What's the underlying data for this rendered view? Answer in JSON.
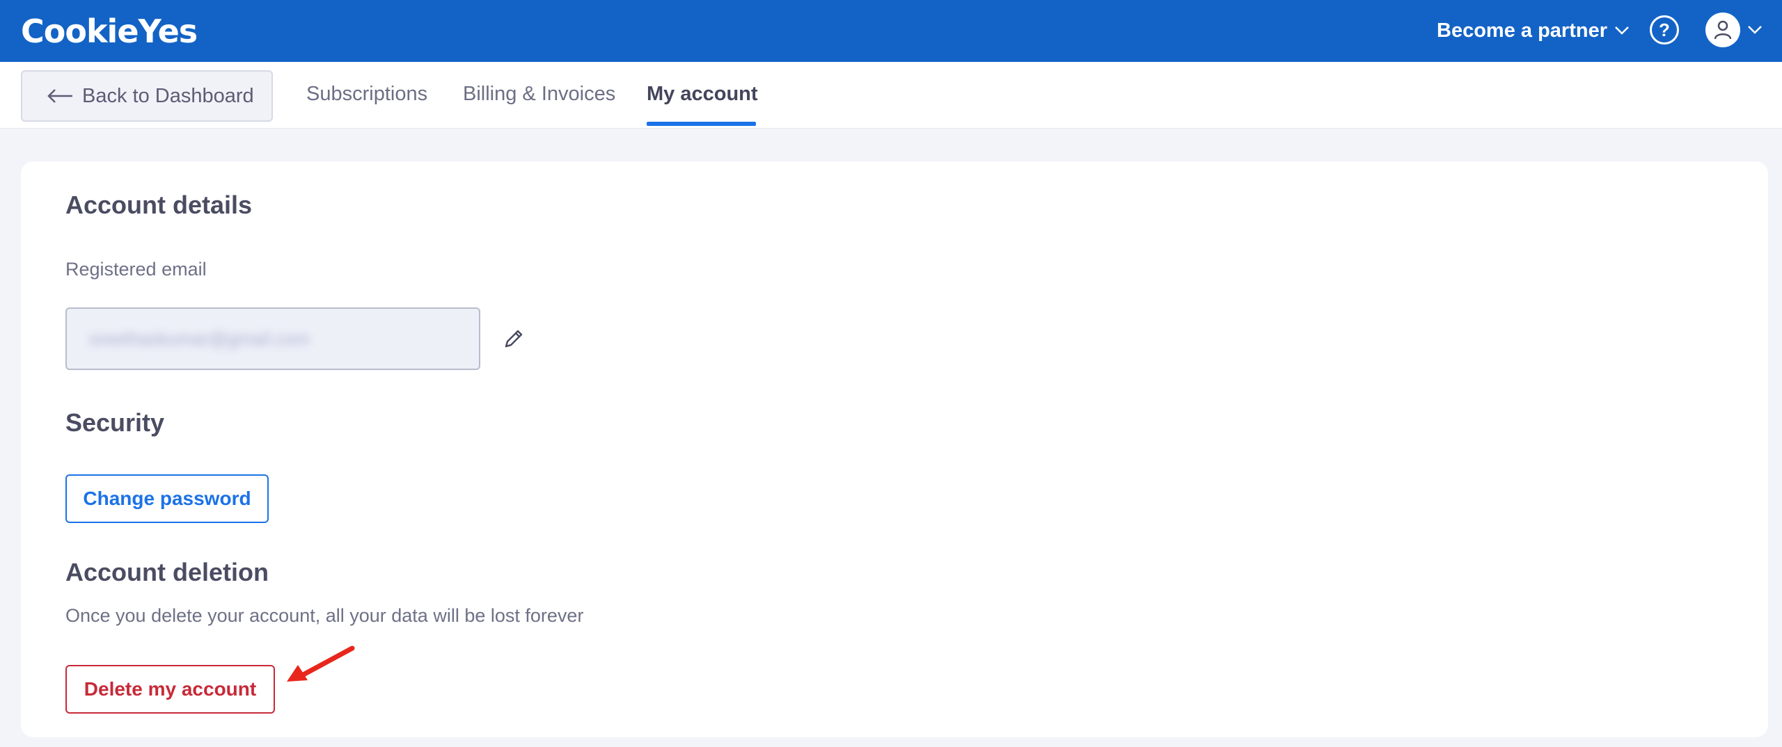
{
  "topbar": {
    "logo": "CookieYes",
    "partner_label": "Become a partner",
    "help_icon": "question-circle-icon",
    "avatar_icon": "user-icon",
    "colors": {
      "background": "#1363c6",
      "text": "#ffffff"
    }
  },
  "nav": {
    "back_label": "Back to Dashboard",
    "tabs": [
      {
        "label": "Subscriptions",
        "active": false
      },
      {
        "label": "Billing & Invoices",
        "active": false
      },
      {
        "label": "My account",
        "active": true
      }
    ],
    "accent": "#1b72e8"
  },
  "account_details": {
    "heading": "Account details",
    "email_label": "Registered email",
    "email_value": "sreethaskumar@gmail.com"
  },
  "security": {
    "heading": "Security",
    "change_password_label": "Change password"
  },
  "account_deletion": {
    "heading": "Account deletion",
    "description": "Once you delete your account, all your data will be lost forever",
    "delete_label": "Delete my account",
    "danger_color": "#c72a38"
  }
}
